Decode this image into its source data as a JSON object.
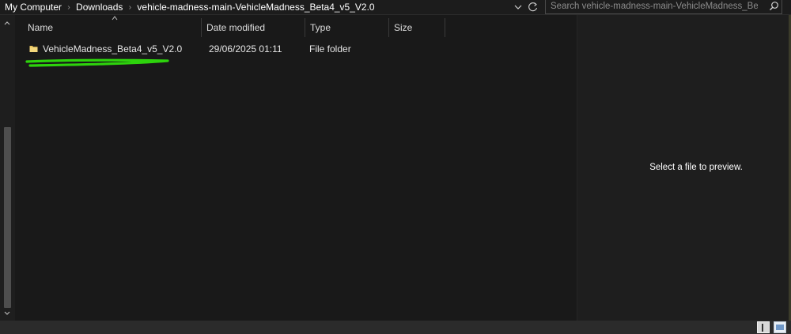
{
  "address_bar": {
    "breadcrumb": [
      "My Computer",
      "Downloads",
      "vehicle-madness-main-VehicleMadness_Beta4_v5_V2.0"
    ]
  },
  "search": {
    "placeholder": "Search vehicle-madness-main-VehicleMadness_Beta4_v..."
  },
  "file_list": {
    "columns": [
      "Name",
      "Date modified",
      "Type",
      "Size"
    ],
    "rows": [
      {
        "name": "VehicleMadness_Beta4_v5_V2.0",
        "date_modified": "29/06/2025 01:11",
        "type": "File folder",
        "size": ""
      }
    ]
  },
  "preview": {
    "message": "Select a file to preview."
  },
  "icons": {
    "folder": "folder-icon",
    "search": "search-icon",
    "refresh": "refresh-icon",
    "chevron": "chevron-right-icon",
    "dropdown": "chevron-down-icon"
  },
  "colors": {
    "highlight_annotation": "#2dd30c",
    "folder": "#e8c25a",
    "background": "#191919"
  }
}
